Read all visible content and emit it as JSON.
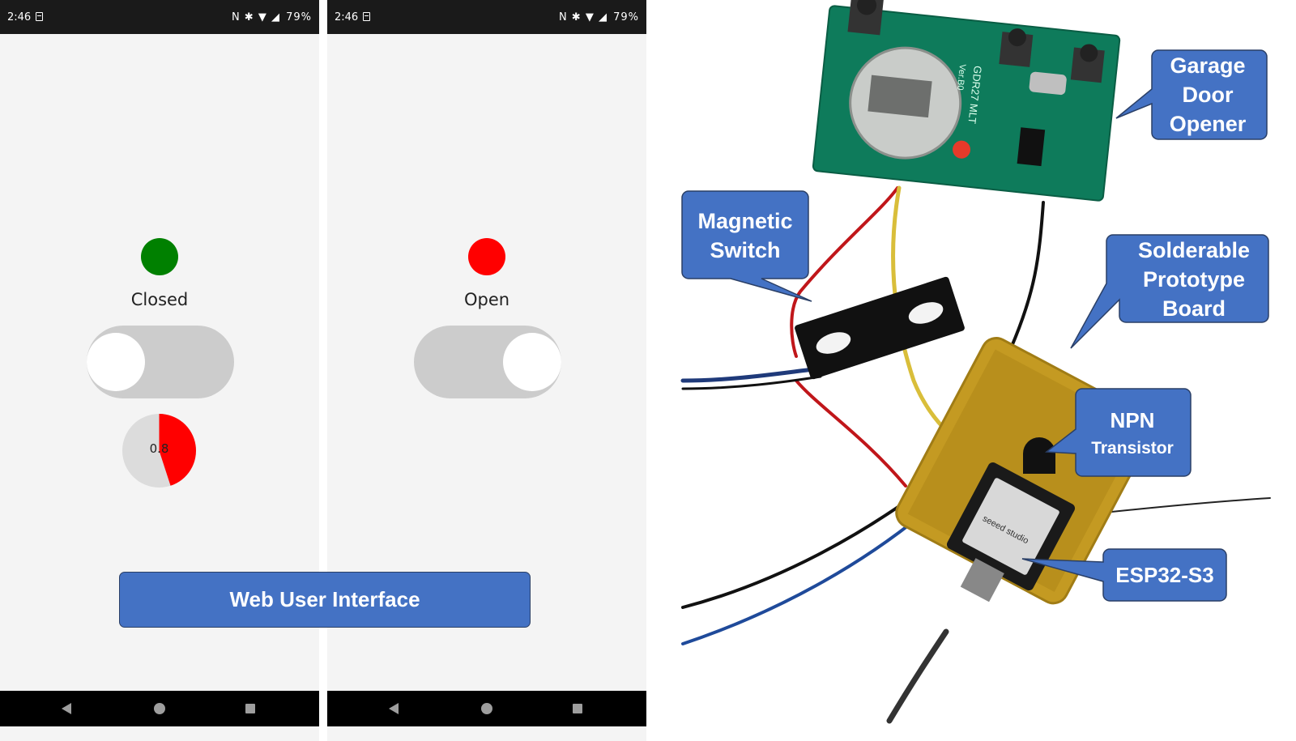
{
  "phones": [
    {
      "status_time": "2:46",
      "status_icons": "N ✱ ▼ ◢",
      "battery": "79%",
      "state_label": "Closed",
      "led_color": "#008000",
      "toggle_on": false,
      "gauge_value_text": "0.8",
      "gauge_fill_fraction": 0.45,
      "gauge_fill_color": "#ff0000"
    },
    {
      "status_time": "2:46",
      "status_icons": "N ✱ ▼ ◢",
      "battery": "79%",
      "state_label": "Open",
      "led_color": "#ff0000",
      "toggle_on": true
    }
  ],
  "banner": {
    "label": "Web User Interface",
    "color": "#4472c4"
  },
  "callouts": {
    "garage_door_opener": [
      "Garage",
      "Door",
      "Opener"
    ],
    "magnetic_switch": [
      "Magnetic",
      "Switch"
    ],
    "solderable_board": [
      "Solderable",
      "Prototype",
      "Board"
    ],
    "npn_transistor": [
      "NPN",
      "Transistor"
    ],
    "esp32": [
      "ESP32-S3"
    ]
  },
  "pcb": {
    "silkscreen_model": "GDR27 MLT",
    "silkscreen_ver": "Ver.B0",
    "module_brand": "seeed studio"
  }
}
